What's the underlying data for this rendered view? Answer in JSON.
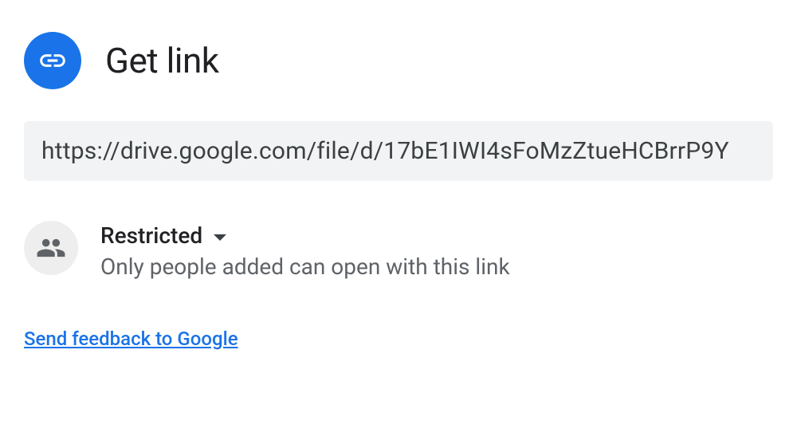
{
  "header": {
    "title": "Get link"
  },
  "url": "https://drive.google.com/file/d/17bE1IWI4sFoMzZtueHCBrrP9Y",
  "access": {
    "level": "Restricted",
    "description": "Only people added can open with this link"
  },
  "feedback_link": "Send feedback to Google"
}
